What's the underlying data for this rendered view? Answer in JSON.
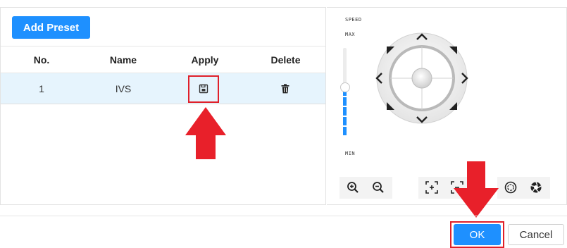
{
  "preset": {
    "add_button": "Add Preset",
    "columns": [
      "No.",
      "Name",
      "Apply",
      "Delete"
    ],
    "rows": [
      {
        "no": "1",
        "name": "IVS"
      }
    ]
  },
  "ptz": {
    "speed_label": "SPEED",
    "max_label": "MAX",
    "min_label": "MIN",
    "speed_level": 0.55
  },
  "footer": {
    "ok_label": "OK",
    "cancel_label": "Cancel"
  },
  "colors": {
    "accent": "#1e90ff",
    "highlight": "#e0202a",
    "row_selected": "#e6f4fd"
  }
}
